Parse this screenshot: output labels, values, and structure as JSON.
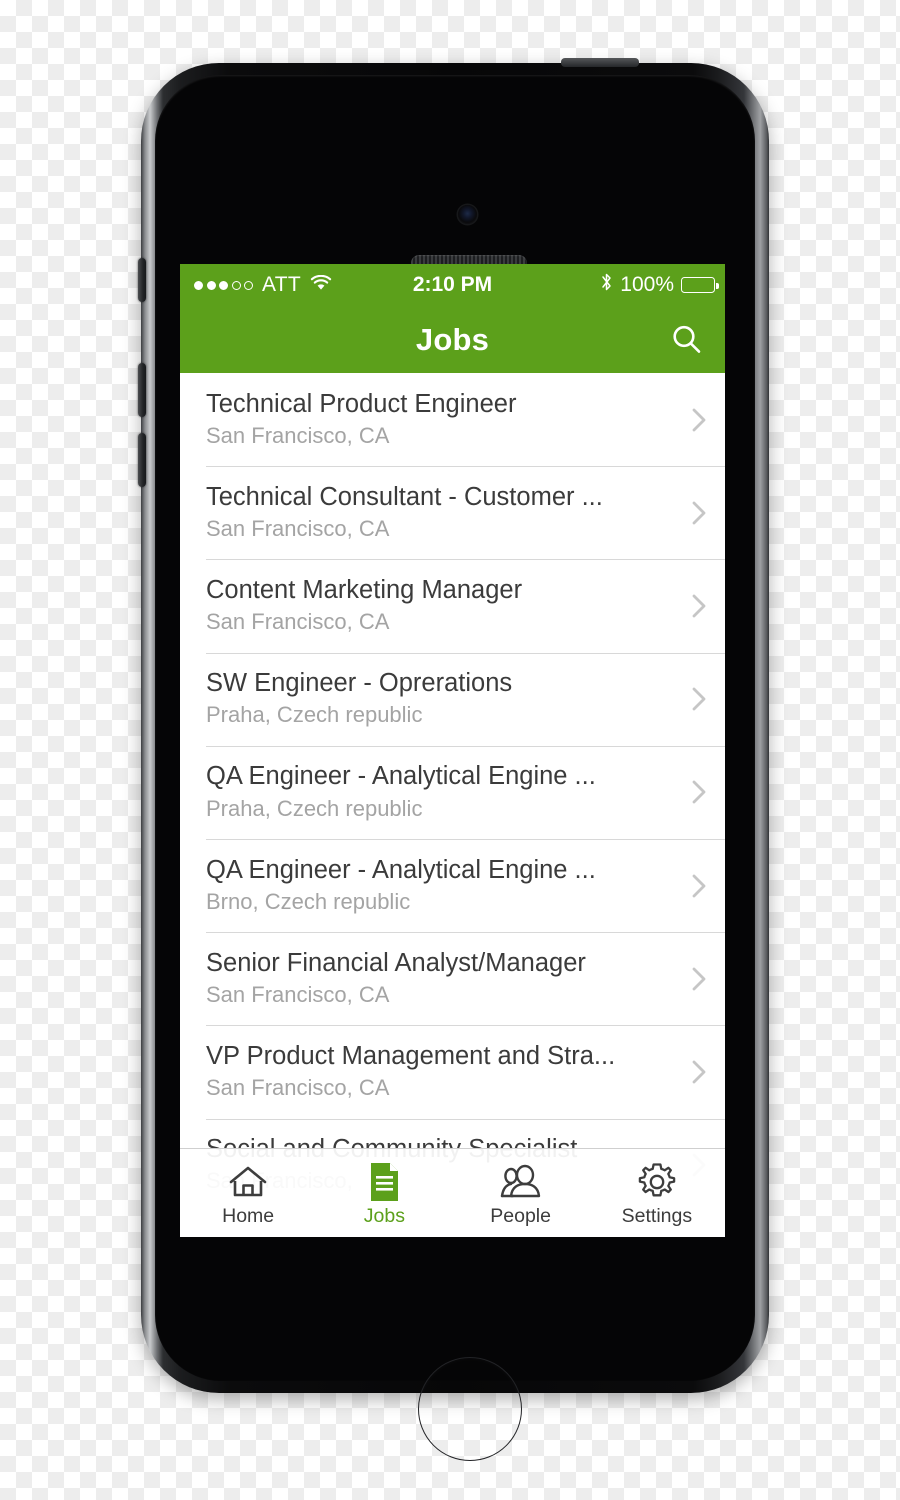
{
  "status_bar": {
    "signal_dots_total": 5,
    "signal_dots_filled": 3,
    "carrier": "ATT",
    "wifi_icon": "wifi-icon",
    "time": "2:10 PM",
    "bluetooth_icon": "bluetooth-icon",
    "battery_percent": "100%",
    "battery_icon": "battery-full-icon"
  },
  "nav_bar": {
    "title": "Jobs",
    "search_icon": "search-icon"
  },
  "colors": {
    "brand_green": "#5CA01B",
    "title_text": "#3b3b3b",
    "subtitle_text": "#a4a4a4",
    "divider": "#d8d8d8",
    "chevron": "#c6c6c6"
  },
  "jobs": [
    {
      "title": "Technical Product Engineer",
      "location": "San Francisco, CA"
    },
    {
      "title": "Technical Consultant - Customer ...",
      "location": "San Francisco, CA"
    },
    {
      "title": "Content Marketing Manager",
      "location": "San Francisco, CA"
    },
    {
      "title": "SW Engineer - Oprerations",
      "location": "Praha, Czech republic"
    },
    {
      "title": "QA Engineer - Analytical Engine ...",
      "location": "Praha, Czech republic"
    },
    {
      "title": "QA Engineer - Analytical Engine ...",
      "location": "Brno, Czech republic"
    },
    {
      "title": "Senior Financial Analyst/Manager",
      "location": "San Francisco, CA"
    },
    {
      "title": "VP Product Management and Stra...",
      "location": "San Francisco, CA"
    },
    {
      "title": "Social and Community Specialist",
      "location": "San Francisco,"
    }
  ],
  "tab_bar": {
    "items": [
      {
        "label": "Home",
        "icon": "home-icon",
        "active": false
      },
      {
        "label": "Jobs",
        "icon": "document-icon",
        "active": true
      },
      {
        "label": "People",
        "icon": "people-icon",
        "active": false
      },
      {
        "label": "Settings",
        "icon": "gear-icon",
        "active": false
      }
    ]
  }
}
